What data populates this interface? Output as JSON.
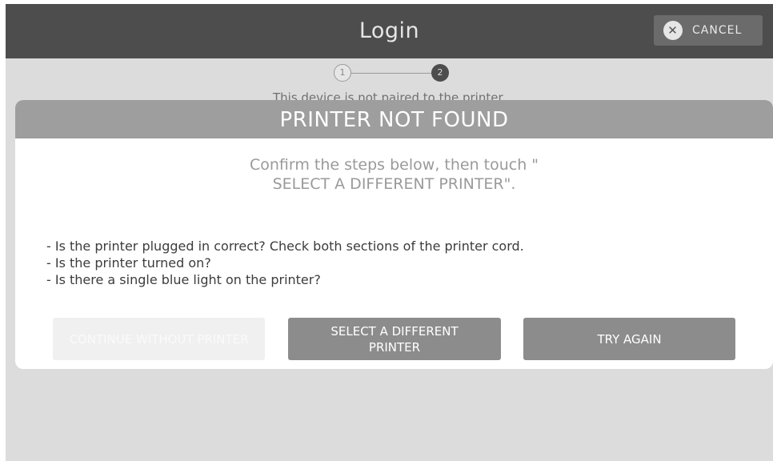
{
  "header": {
    "title": "Login",
    "cancel_label": "CANCEL",
    "cancel_icon": "close-icon"
  },
  "stepper": {
    "steps": [
      "1",
      "2"
    ],
    "current_step": 2
  },
  "background_text": "This device is not paired to the printer.",
  "dialog": {
    "title": "PRINTER NOT FOUND",
    "instruction": "Confirm the steps below, then touch \"\nSELECT A DIFFERENT PRINTER\".",
    "checklist": [
      "- Is the printer plugged in correct?  Check both sections of the printer cord.",
      "- Is the printer turned on?",
      "- Is there a single blue light on the printer?"
    ],
    "buttons": {
      "continue_label": "CONTINUE WITHOUT PRINTER",
      "select_label": "SELECT A DIFFERENT PRINTER",
      "retry_label": "TRY AGAIN"
    }
  },
  "colors": {
    "header_bg": "#4d4d4d",
    "dialog_header_bg": "#9e9e9e",
    "button_bg": "#8c8c8c",
    "disabled_button_bg": "#f0f0f0",
    "backdrop": "#dcdcdc"
  }
}
